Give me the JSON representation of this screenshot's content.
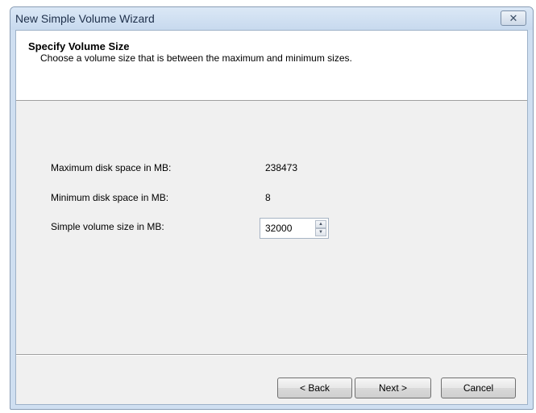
{
  "window": {
    "title": "New Simple Volume Wizard",
    "close_glyph": "✕"
  },
  "header": {
    "title": "Specify Volume Size",
    "subtitle": "Choose a volume size that is between the maximum and minimum sizes."
  },
  "fields": {
    "max_label": "Maximum disk space in MB:",
    "max_value": "238473",
    "min_label": "Minimum disk space in MB:",
    "min_value": "8",
    "size_label": "Simple volume size in MB:",
    "size_value": "32000"
  },
  "buttons": {
    "back": "< Back",
    "next": "Next >",
    "cancel": "Cancel"
  },
  "icons": {
    "spin_up": "▲",
    "spin_down": "▼"
  }
}
